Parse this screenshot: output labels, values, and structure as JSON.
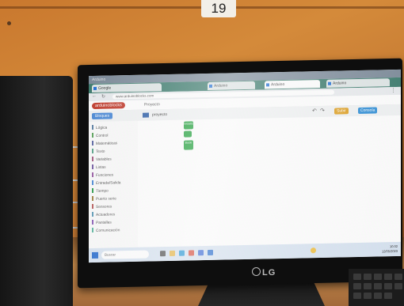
{
  "scene": {
    "label_tag": "19",
    "monitor_brand": "LG"
  },
  "browser": {
    "window_title": "Arduino",
    "tabs": [
      {
        "label": "Google"
      },
      {
        "label": "Arduino"
      },
      {
        "label": "Arduino"
      },
      {
        "label": "Arduino"
      }
    ],
    "url": "www.arduinoblocks.com"
  },
  "app": {
    "brand": "arduinoblocks",
    "project_label": "Proyecto",
    "blocks_button": "Bloques",
    "file_name": "proyecto",
    "toolbar": {
      "upload_label": "Subir",
      "console_label": "Consola"
    },
    "categories": [
      {
        "label": "Lógica",
        "color": "#5b80a5"
      },
      {
        "label": "Control",
        "color": "#5ba55b"
      },
      {
        "label": "Matemáticas",
        "color": "#5b67a5"
      },
      {
        "label": "Texto",
        "color": "#5ba58c"
      },
      {
        "label": "Variables",
        "color": "#a55b80"
      },
      {
        "label": "Listas",
        "color": "#745ba5"
      },
      {
        "label": "Funciones",
        "color": "#9a5ba5"
      },
      {
        "label": "Entrada/Salida",
        "color": "#4a8ad8"
      },
      {
        "label": "Tiempo",
        "color": "#2f9e4f"
      },
      {
        "label": "Puerto serie",
        "color": "#a08040"
      },
      {
        "label": "Sensores",
        "color": "#b85b5b"
      },
      {
        "label": "Actuadores",
        "color": "#5b9ab8"
      },
      {
        "label": "Pantallas",
        "color": "#8a5bb8"
      },
      {
        "label": "Comunicación",
        "color": "#5bb8a0"
      }
    ],
    "workspace_blocks": [
      {
        "label": "Inicializar"
      },
      {
        "label": "Bucle"
      }
    ]
  },
  "taskbar": {
    "search_placeholder": "Buscar",
    "time": "10:32",
    "date": "12/05/2023"
  },
  "colors": {
    "wall": "#c9782e",
    "block_green": "#1fa13a",
    "brand_red": "#c33b2c",
    "tab_teal": "#3a7a6c"
  }
}
